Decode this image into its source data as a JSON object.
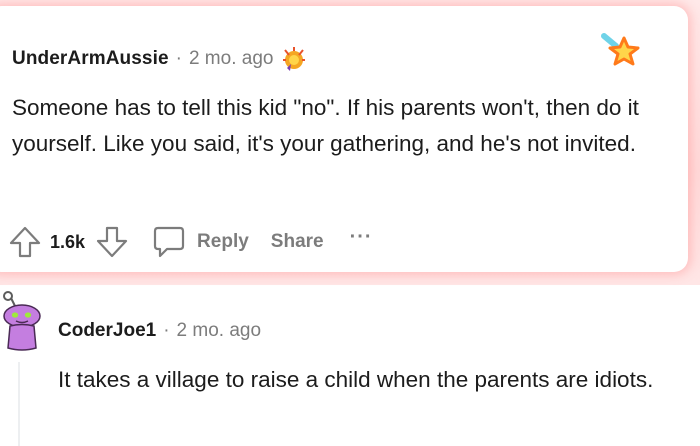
{
  "comment1": {
    "author": "UnderArmAussie",
    "separator": "·",
    "time": "2 mo. ago",
    "body": "Someone has to tell this kid \"no\". If his parents won't, then do it yourself. Like you said, it's your gathering, and he's not invited.",
    "score": "1.6k",
    "reply_label": "Reply",
    "share_label": "Share",
    "more_label": "···",
    "icons": [
      "upvote-icon",
      "downvote-icon",
      "comment-bubble-icon",
      "award-icon",
      "star-award-icon"
    ]
  },
  "comment2": {
    "author": "CoderJoe1",
    "separator": "·",
    "time": "2 mo. ago",
    "body": "It takes a village to raise a child when the parents are idiots."
  },
  "colors": {
    "highlight_glow": "#ffd9d9",
    "meta_gray": "#7c7c7c",
    "text": "#1c1c1c",
    "avatar_purple": "#c47ee0"
  }
}
